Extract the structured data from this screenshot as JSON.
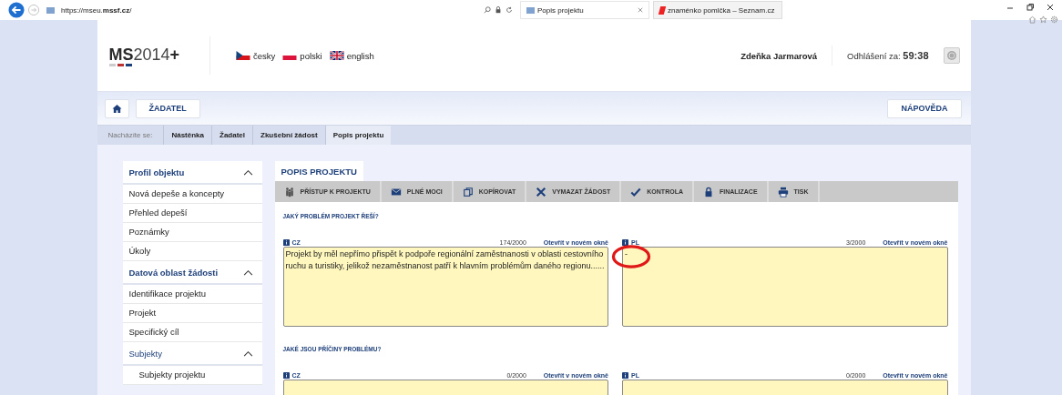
{
  "browser": {
    "url_host": "https://mseu.",
    "url_domain": "mssf.cz",
    "url_rest": "/",
    "tabs": [
      {
        "label": "Popis projektu",
        "selected": true
      },
      {
        "label": "znaménko pomlčka – Seznam.cz",
        "selected": false
      }
    ]
  },
  "header": {
    "logo_bold": "MS",
    "logo_light": "2014",
    "logo_plus": "+",
    "languages": [
      {
        "label": "česky",
        "kind": "cz"
      },
      {
        "label": "polski",
        "kind": "pl"
      },
      {
        "label": "english",
        "kind": "gb"
      }
    ],
    "user": "Zdeňka Jarmarová",
    "logout_label": "Odhlášení za:",
    "logout_time": "59:38"
  },
  "nav": {
    "role": "ŽADATEL",
    "help": "NÁPOVĚDA"
  },
  "breadcrumb": {
    "label": "Nacházíte se:",
    "items": [
      "Nástěnka",
      "Žadatel",
      "Zkušební žádost",
      "Popis projektu"
    ]
  },
  "sidebar": [
    {
      "title": "Profil objektu",
      "expanded": true,
      "items": [
        {
          "label": "Nová depeše a koncepty"
        },
        {
          "label": "Přehled depeší"
        },
        {
          "label": "Poznámky"
        },
        {
          "label": "Úkoly"
        }
      ]
    },
    {
      "title": "Datová oblast žádosti",
      "expanded": true,
      "items": [
        {
          "label": "Identifikace projektu"
        },
        {
          "label": "Projekt"
        },
        {
          "label": "Specifický cíl"
        },
        {
          "label": "Subjekty",
          "expanded": true,
          "children": [
            {
              "label": "Subjekty projektu"
            }
          ]
        }
      ]
    }
  ],
  "main": {
    "tab": "POPIS PROJEKTU",
    "toolbar": [
      {
        "label": "PŘÍSTUP K PROJEKTU",
        "kind": "people"
      },
      {
        "label": "PLNÉ MOCI",
        "kind": "mail"
      },
      {
        "label": "KOPÍROVAT",
        "kind": "copy"
      },
      {
        "label": "VYMAZAT ŽÁDOST",
        "kind": "delete"
      },
      {
        "label": "KONTROLA",
        "kind": "check"
      },
      {
        "label": "FINALIZACE",
        "kind": "lock"
      },
      {
        "label": "TISK",
        "kind": "print"
      }
    ],
    "questions": [
      {
        "label": "JAKÝ PROBLÉM PROJEKT ŘEŠÍ?",
        "fields": [
          {
            "lang": "CZ",
            "count": "174/2000",
            "link": "Otevřít v novém okně",
            "value": "Projekt by měl nepřímo přispět k podpoře regionální zaměstnanosti v oblasti cestovního ruchu a turistiky, jelikož nezaměstnanost patří k hlavním problémům daného regionu......",
            "circled": false
          },
          {
            "lang": "PL",
            "count": "3/2000",
            "link": "Otevřít v novém okně",
            "value": "-",
            "circled": true
          }
        ]
      },
      {
        "label": "JAKÉ JSOU PŘÍČINY PROBLÉMU?",
        "fields": [
          {
            "lang": "CZ",
            "count": "0/2000",
            "link": "Otevřít v novém okně",
            "circled": false
          },
          {
            "lang": "PL",
            "count": "0/2000",
            "link": "Otevřít v novém okně",
            "circled": false
          }
        ]
      }
    ]
  }
}
